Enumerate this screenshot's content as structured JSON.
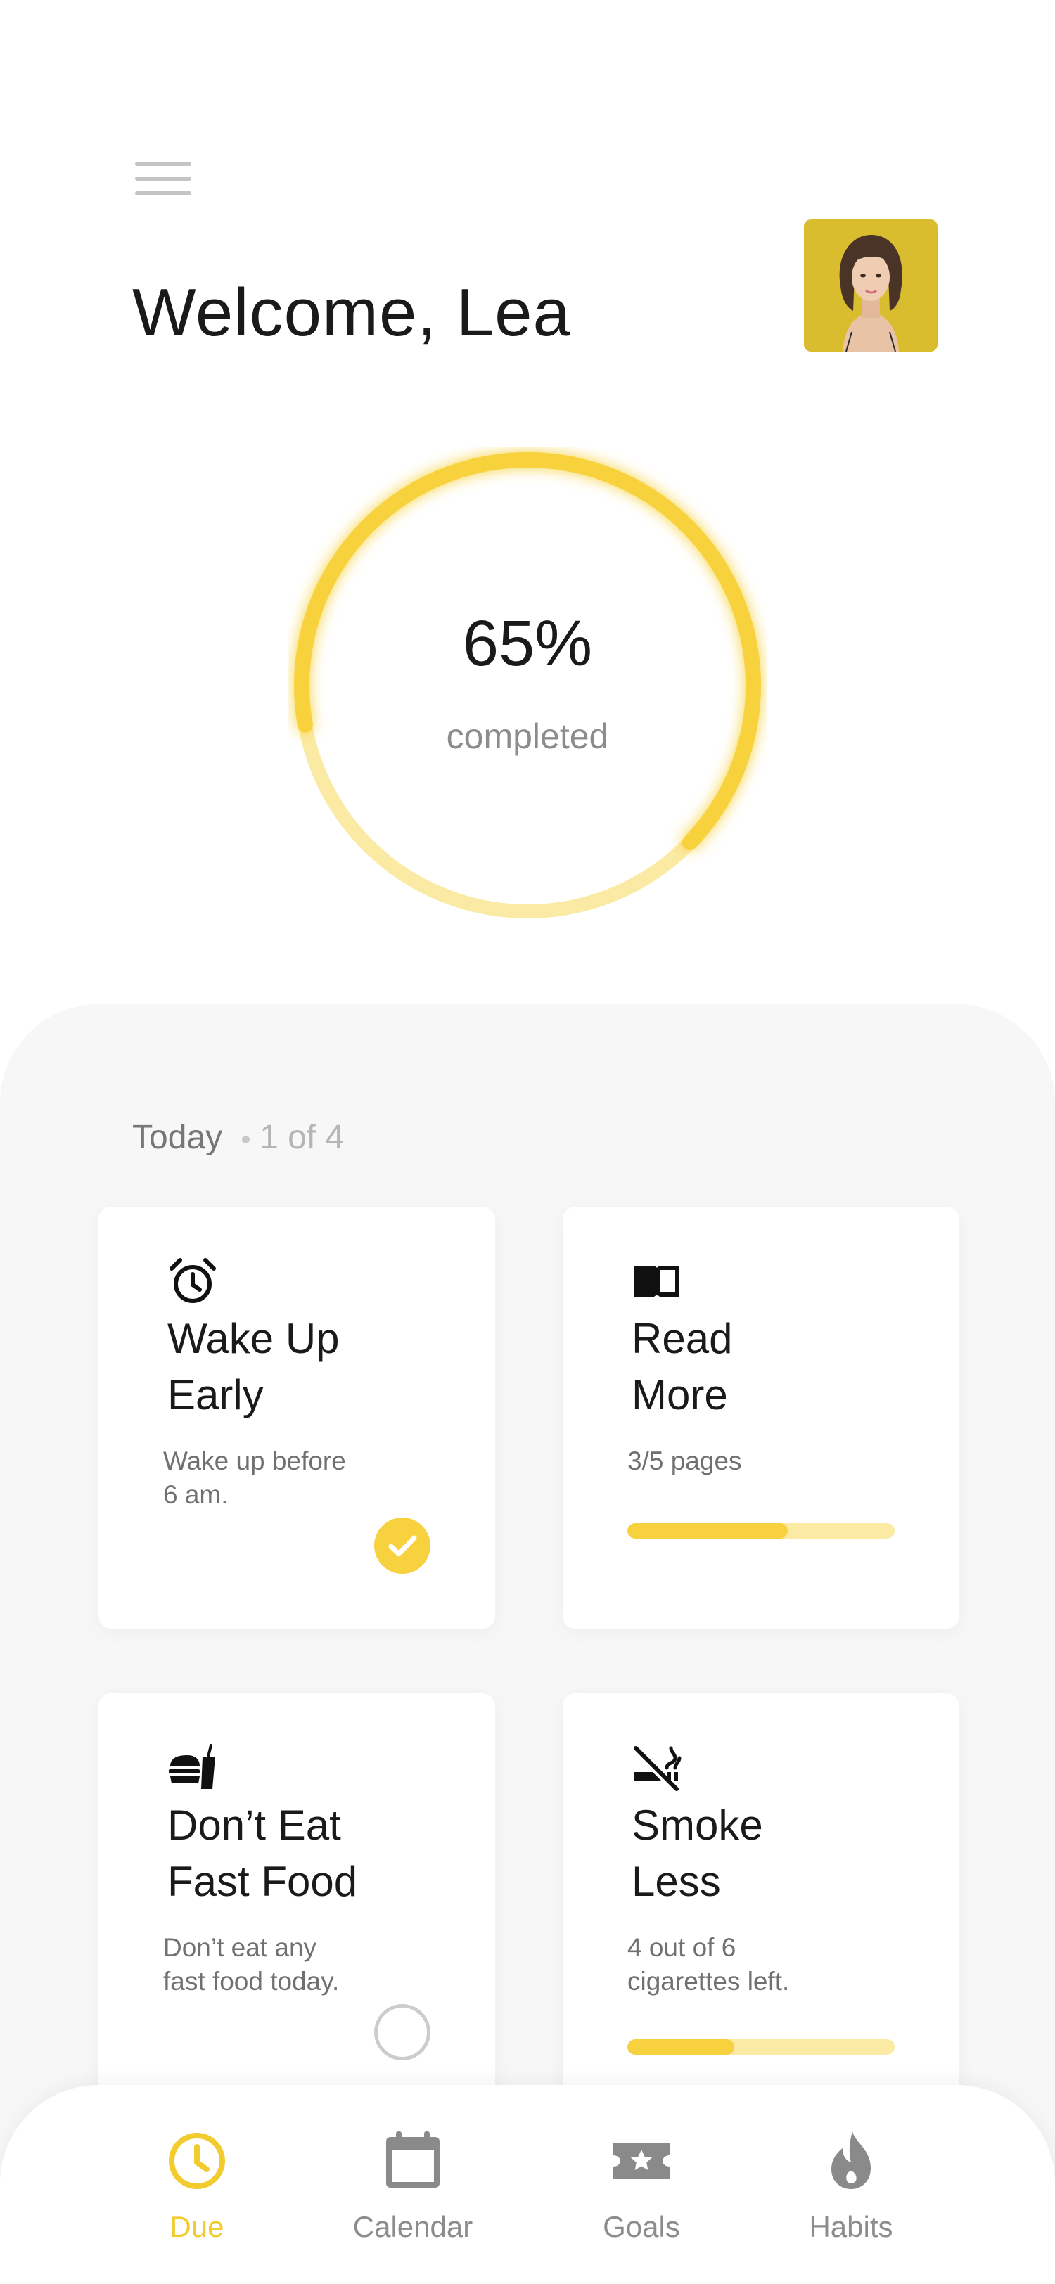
{
  "colors": {
    "accent": "#f7d23e",
    "accent_light": "#fbeaa4",
    "text_dark": "#1a1a1a",
    "text_muted": "#8c8c8c",
    "panel_bg": "#f7f7f7"
  },
  "header": {
    "menu_icon": "hamburger-icon",
    "greeting": "Welcome,",
    "user_name": "Lea",
    "avatar": "user-avatar"
  },
  "progress": {
    "percent_label": "65%",
    "percent_value": 0.65,
    "label": "completed"
  },
  "today": {
    "label": "Today",
    "count": "1 of 4"
  },
  "habits": [
    {
      "icon": "alarm-clock-icon",
      "title_line1": "Wake Up",
      "title_line2": "Early",
      "desc_line1": "Wake up before",
      "desc_line2": "6 am.",
      "status": "done"
    },
    {
      "icon": "book-icon",
      "title_line1": "Read",
      "title_line2": "More",
      "desc_line1": "3/5 pages",
      "desc_line2": "",
      "progress": 0.6
    },
    {
      "icon": "fast-food-icon",
      "title_line1": "Don’t Eat",
      "title_line2": "Fast Food",
      "desc_line1": "Don’t eat any",
      "desc_line2": "fast food today.",
      "status": "pending"
    },
    {
      "icon": "no-smoking-icon",
      "title_line1": "Smoke",
      "title_line2": "Less",
      "desc_line1": "4 out of 6",
      "desc_line2": "cigarettes left.",
      "progress": 0.4
    }
  ],
  "nav": {
    "items": [
      {
        "label": "Due",
        "icon": "clock-icon",
        "active": true
      },
      {
        "label": "Calendar",
        "icon": "calendar-icon",
        "active": false
      },
      {
        "label": "Goals",
        "icon": "ticket-star-icon",
        "active": false
      },
      {
        "label": "Habits",
        "icon": "flame-icon",
        "active": false
      }
    ]
  }
}
